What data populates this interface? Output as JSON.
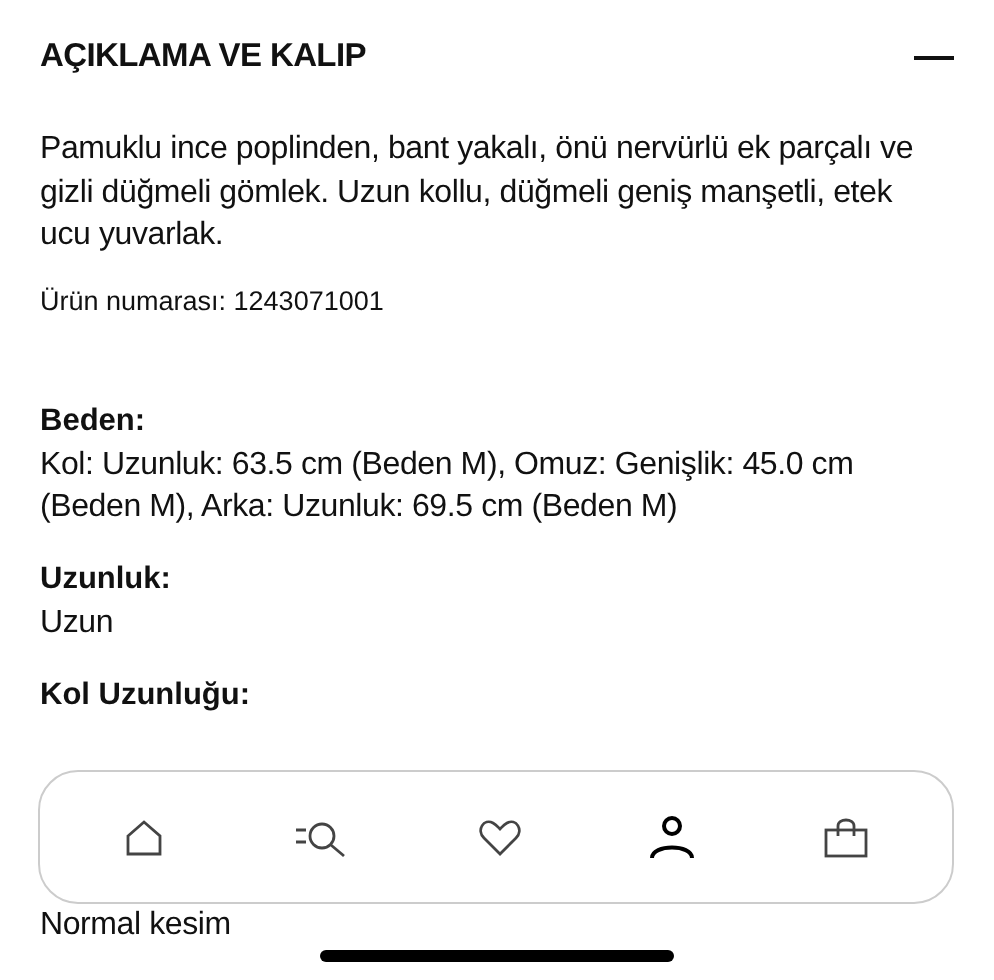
{
  "section": {
    "title": "AÇIKLAMA VE KALIP",
    "expanded": true,
    "description": "Pamuklu ince poplinden, bant yakalı, önü nervürlü ek parçalı ve gizli düğmeli gömlek. Uzun kollu, düğmeli geniş manşetli, etek ucu yuvarlak.",
    "product_number": "Ürün numarası: 1243071001",
    "attributes": [
      {
        "label": "Beden:",
        "value": "Kol: Uzunluk: 63.5 cm (Beden M), Omuz: Genişlik: 45.0 cm (Beden M), Arka: Uzunluk: 69.5 cm (Beden M)"
      },
      {
        "label": "Uzunluk:",
        "value": "Uzun"
      },
      {
        "label": "Kol Uzunluğu:"
      },
      {
        "value": "Normal kesim"
      }
    ]
  },
  "tab_bar": {
    "items": [
      {
        "kind": "home",
        "selected": false
      },
      {
        "kind": "search",
        "selected": false
      },
      {
        "kind": "favorites",
        "selected": false
      },
      {
        "kind": "account",
        "selected": true
      },
      {
        "kind": "bag",
        "selected": false
      }
    ]
  }
}
